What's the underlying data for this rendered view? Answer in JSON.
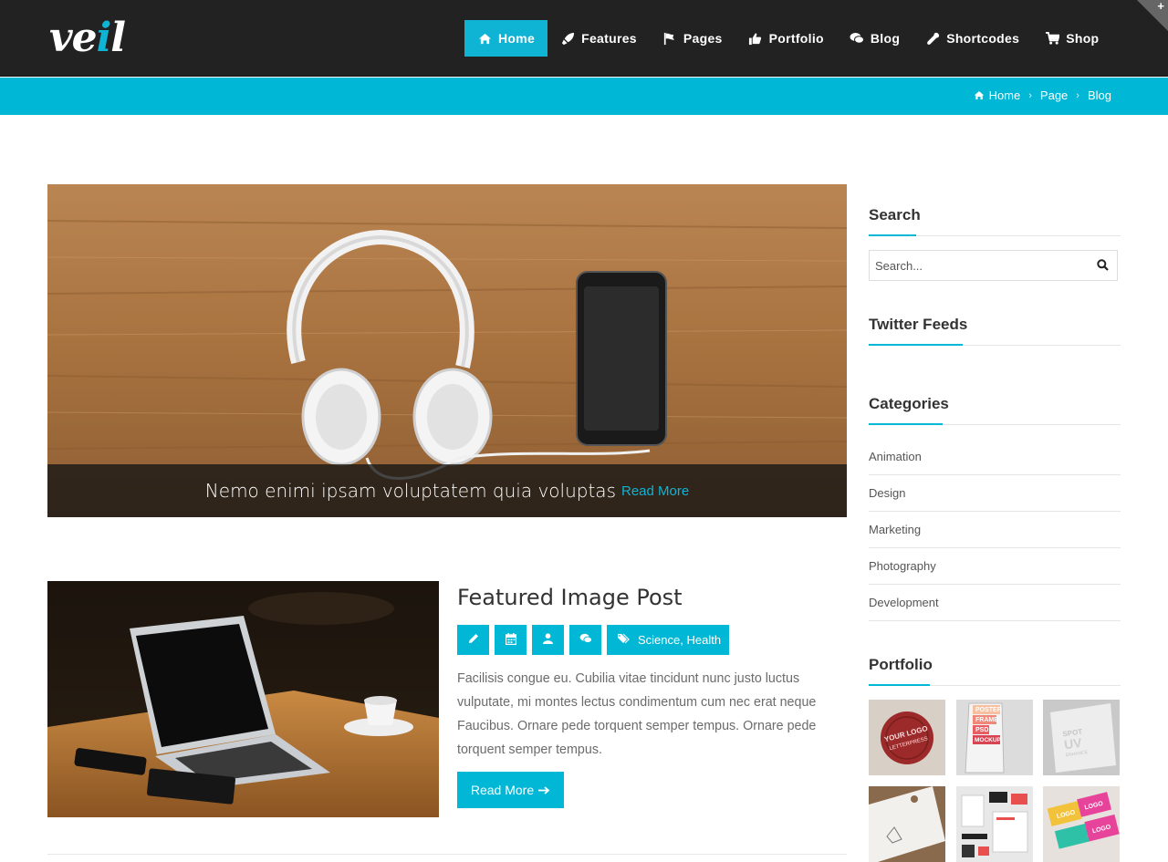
{
  "brand": {
    "logo_left": "ve",
    "logo_accent": "i",
    "logo_right": "l"
  },
  "nav": [
    {
      "label": "Home",
      "icon": "home-icon",
      "active": true
    },
    {
      "label": "Features",
      "icon": "rocket-icon"
    },
    {
      "label": "Pages",
      "icon": "flag-icon"
    },
    {
      "label": "Portfolio",
      "icon": "thumbs-up-icon"
    },
    {
      "label": "Blog",
      "icon": "comments-icon"
    },
    {
      "label": "Shortcodes",
      "icon": "wrench-icon"
    },
    {
      "label": "Shop",
      "icon": "cart-icon"
    }
  ],
  "breadcrumb": {
    "home": "Home",
    "page": "Page",
    "current": "Blog"
  },
  "hero": {
    "title": "Nemo enimi ipsam voluptatem quia voluptas",
    "read_more": "Read More"
  },
  "post": {
    "title": "Featured Image Post",
    "tags": "Science, Health",
    "text": "Facilisis congue eu. Cubilia vitae tincidunt nunc justo luctus vulputate, mi montes lectus condimentum cum nec erat neque Faucibus. Ornare pede torquent semper tempus. Ornare pede torquent semper tempus.",
    "read_more": "Read More"
  },
  "sidebar": {
    "search_title": "Search",
    "search_placeholder": "Search...",
    "twitter_title": "Twitter Feeds",
    "categories_title": "Categories",
    "categories": [
      "Animation",
      "Design",
      "Marketing",
      "Photography",
      "Development"
    ],
    "portfolio_title": "Portfolio",
    "portfolio": [
      {
        "l1": "YOUR LOGO",
        "l2": "LETTERPRESS"
      },
      {
        "l1": "POSTER",
        "l2": "FRAME",
        "l3": "PSD",
        "l4": "MOCKUP"
      },
      {
        "l1": "SPOT",
        "l2": "UV",
        "l3": "ENHANCE"
      },
      {
        "l1": ""
      },
      {
        "l1": ""
      },
      {
        "l1": "LOGO",
        "l2": "LOGO",
        "l3": "LOGO"
      }
    ]
  },
  "colors": {
    "accent": "#00b7d6",
    "header": "#222222"
  }
}
